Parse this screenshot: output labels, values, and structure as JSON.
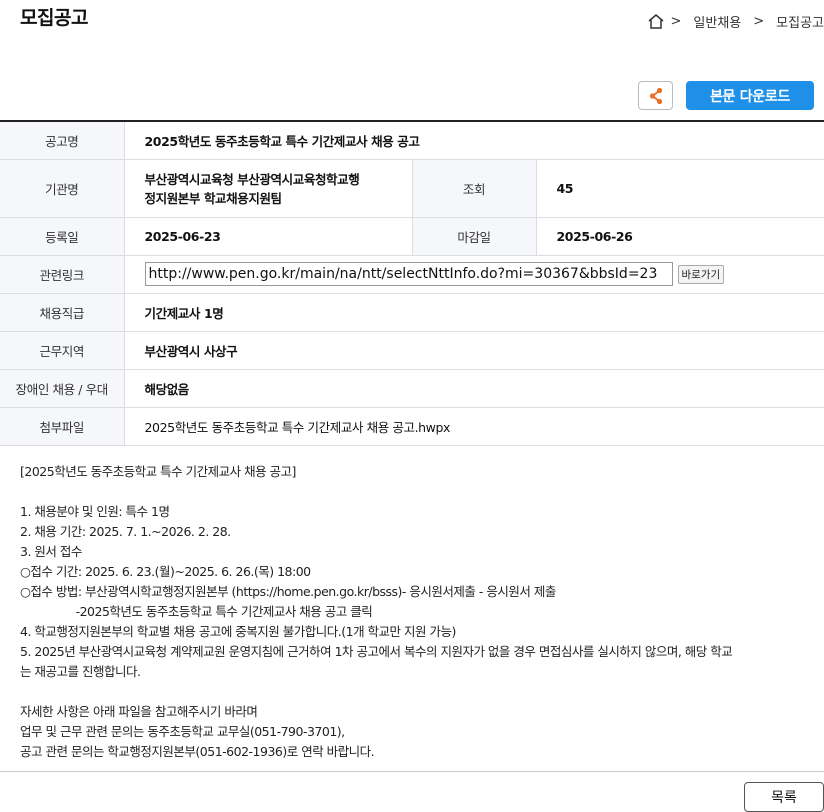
{
  "header": {
    "title": "모집공고",
    "breadcrumb": [
      ">",
      "일반채용",
      ">",
      "모집공고"
    ]
  },
  "toolbar": {
    "download_label": "본문 다운로드"
  },
  "info": {
    "notice_label": "공고명",
    "notice_value": "2025학년도 동주초등학교 특수 기간제교사 채용 공고",
    "agency_label": "기관명",
    "agency_value_line1": "부산광역시교육청 부산광역시교육청학교행",
    "agency_value_line2": "정지원본부 학교채용지원팀",
    "views_label": "조회",
    "views_value": "45",
    "reg_date_label": "등록일",
    "reg_date_value": "2025-06-23",
    "deadline_label": "마감일",
    "deadline_value": "2025-06-26",
    "link_label": "관련링크",
    "link_value": "http://www.pen.go.kr/main/na/ntt/selectNttInfo.do?mi=30367&bbsId=23",
    "link_go_label": "바로가기",
    "position_label": "채용직급",
    "position_value": "기간제교사 1명",
    "region_label": "근무지역",
    "region_value": "부산광역시 사상구",
    "disability_label": "장애인 채용 / 우대",
    "disability_value": "해당없음",
    "attachment_label": "첨부파일",
    "attachment_value": "2025학년도 동주초등학교 특수 기간제교사 채용 공고.hwpx"
  },
  "body": {
    "lines": [
      "[2025학년도 동주초등학교 특수 기간제교사 채용 공고]",
      "",
      "1. 채용분야 및 인원: 특수 1명",
      "2. 채용 기간: 2025. 7. 1.~2026. 2. 28.",
      "3. 원서 접수",
      "○접수 기간: 2025. 6. 23.(월)~2025. 6. 26.(목) 18:00",
      "○접수 방법: 부산광역시학교행정지원본부 (https://home.pen.go.kr/bsss)- 응시원서제출 - 응시원서 제출",
      "                -2025학년도 동주초등학교 특수 기간제교사 채용 공고 클릭",
      "4. 학교행정지원본부의 학교별 채용 공고에 중복지원 불가합니다.(1개 학교만 지원 가능)",
      "5. 2025년 부산광역시교육청 계약제교원 운영지침에 근거하여 1차 공고에서 복수의 지원자가 없을 경우 면접심사를 실시하지 않으며, 해당 학교",
      "는 재공고를 진행합니다.",
      "",
      "자세한 사항은 아래 파일을 참고해주시기 바라며",
      "업무 및 근무 관련 문의는 동주초등학교 교무실(051-790-3701),",
      "공고 관련 문의는 학교행정지원본부(051-602-1936)로 연락 바랍니다."
    ]
  },
  "footer": {
    "list_label": "목록"
  },
  "colors": {
    "accent": "#1e90e8",
    "share_icon": "#e8702a",
    "header_bg": "#f5f7fb"
  }
}
